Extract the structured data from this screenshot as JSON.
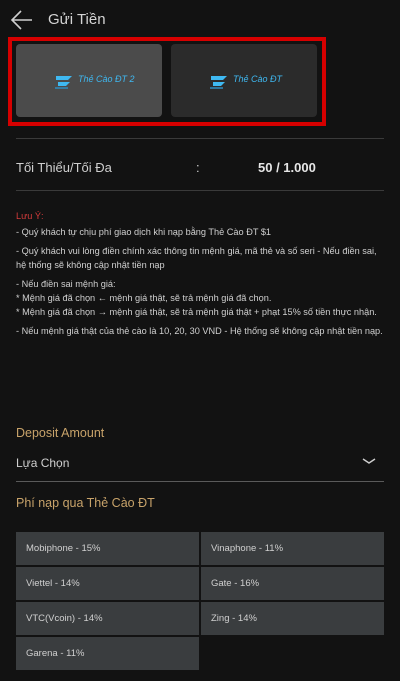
{
  "header": {
    "title": "Gửi Tiền",
    "back_icon": "arrow-left-icon"
  },
  "tabs": [
    {
      "label": "Thẻ Cào ĐT 2",
      "selected": true
    },
    {
      "label": "Thẻ Cào ĐT",
      "selected": false
    }
  ],
  "limits": {
    "label": "Tối Thiểu/Tối Đa",
    "separator": ":",
    "value": "50 / 1.000"
  },
  "notice": {
    "heading": "Lưu Ý:",
    "lines": [
      "- Quý khách tự chịu phí giao dịch khi nạp bằng Thẻ Cào ĐT $1",
      "- Quý khách vui lòng điền chính xác thông tin mệnh giá, mã thẻ và số seri - Nếu điền sai, hệ thống sẽ không cập nhật tiền nạp",
      "- Nếu điền sai mệnh giá:",
      "* Mệnh giá đã chọn ← mệnh giá thật, sẽ trả mệnh giá đã chọn.",
      "* Mệnh giá đã chọn → mệnh giá thật, sẽ trả mệnh giá thật + phạt 15% số tiền thực nhận.",
      "- Nếu mệnh giá thật của thẻ cào là 10, 20, 30 VND - Hệ thống sẽ không cập nhật tiền nạp."
    ]
  },
  "deposit": {
    "label": "Deposit Amount",
    "selected": "Lựa Chọn"
  },
  "fees": {
    "label": "Phí nạp qua Thẻ Cào ĐT",
    "items": [
      "Mobiphone - 15%",
      "Vinaphone - 11%",
      "Viettel - 14%",
      "Gate - 16%",
      "VTC(Vcoin) - 14%",
      "Zing - 14%",
      "Garena - 11%"
    ]
  },
  "colors": {
    "accent": "#c8a36a",
    "warning": "#d43b3b",
    "highlight": "#d60000",
    "logo": "#3fb9f2"
  }
}
